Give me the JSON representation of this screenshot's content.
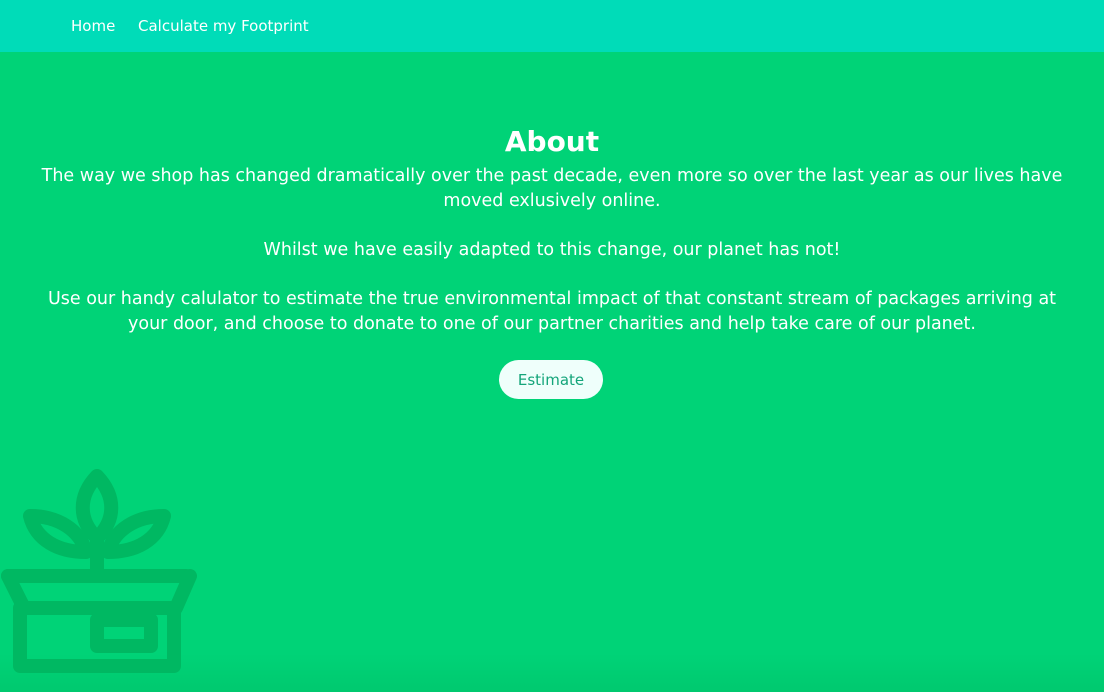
{
  "nav": {
    "items": [
      {
        "label": "Home"
      },
      {
        "label": "Calculate my Footprint"
      }
    ]
  },
  "about": {
    "title": "About",
    "paragraphs": [
      "The way we shop has changed dramatically over the past decade, even more so over the last year as our lives have moved exlusively online.",
      "Whilst we have easily adapted to this change, our planet has not!",
      "Use our handy calulator to estimate the true environmental impact of that constant stream of packages arriving at your door, and choose to donate to one of our partner charities and help take care of our planet."
    ],
    "button_label": "Estimate"
  },
  "decoration": {
    "icon": "plant-in-box-icon",
    "color": "#00b862"
  },
  "colors": {
    "nav_bg": "#00dcb8",
    "page_bg": "#00d377",
    "button_bg": "#effffb",
    "button_text": "#14a57a"
  }
}
